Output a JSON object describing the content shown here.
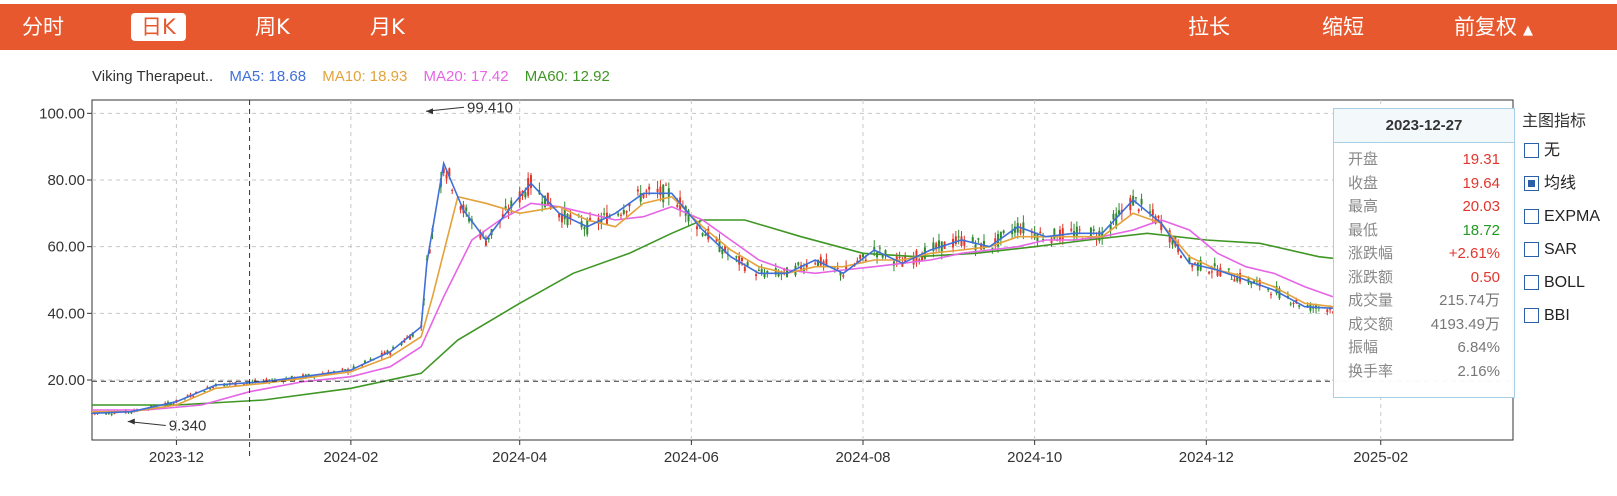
{
  "toolbar": {
    "tabs": [
      {
        "label": "分时",
        "active": false
      },
      {
        "label": "日K",
        "active": true
      },
      {
        "label": "周K",
        "active": false
      },
      {
        "label": "月K",
        "active": false
      }
    ],
    "right": [
      "拉长",
      "缩短",
      "前复权"
    ],
    "adjust_icon": "triangle-up-icon",
    "accent": "#e8582e"
  },
  "legend": {
    "name": "Viking Therapeut..",
    "ma5": "MA5: 18.68",
    "ma10": "MA10: 18.93",
    "ma20": "MA20: 17.42",
    "ma60": "MA60: 12.92"
  },
  "tooltip": {
    "date": "2023-12-27",
    "rows": [
      {
        "k": "开盘",
        "v": "19.31",
        "tone": "red"
      },
      {
        "k": "收盘",
        "v": "19.64",
        "tone": "red"
      },
      {
        "k": "最高",
        "v": "20.03",
        "tone": "red"
      },
      {
        "k": "最低",
        "v": "18.72",
        "tone": "green"
      },
      {
        "k": "涨跌幅",
        "v": "+2.61%",
        "tone": "red"
      },
      {
        "k": "涨跌额",
        "v": "0.50",
        "tone": "red"
      },
      {
        "k": "成交量",
        "v": "215.74万",
        "tone": "gray"
      },
      {
        "k": "成交额",
        "v": "4193.49万",
        "tone": "gray"
      },
      {
        "k": "振幅",
        "v": "6.84%",
        "tone": "gray"
      },
      {
        "k": "换手率",
        "v": "2.16%",
        "tone": "gray"
      }
    ]
  },
  "indicators": {
    "title": "主图指标",
    "items": [
      {
        "label": "无",
        "checked": false
      },
      {
        "label": "均线",
        "checked": true
      },
      {
        "label": "EXPMA",
        "checked": false
      },
      {
        "label": "SAR",
        "checked": false
      },
      {
        "label": "BOLL",
        "checked": false
      },
      {
        "label": "BBI",
        "checked": false
      }
    ]
  },
  "chart_data": {
    "type": "line",
    "title": "",
    "y_ticks": [
      "100.00",
      "80.00",
      "60.00",
      "40.00",
      "20.00"
    ],
    "ylim": [
      2,
      104
    ],
    "xlim": [
      "2023-11-01",
      "2025-03-20"
    ],
    "x_ticks": [
      "2023-12",
      "2024-02",
      "2024-04",
      "2024-06",
      "2024-08",
      "2024-10",
      "2024-12",
      "2025-02"
    ],
    "crosshair": {
      "date": "2023-12-27",
      "price": 19.64
    },
    "annotations": [
      {
        "label": "99.410",
        "date": "2024-02-27",
        "price": 99.41
      },
      {
        "label": "9.340",
        "date": "2023-11-13",
        "price": 9.34
      }
    ],
    "series": [
      {
        "name": "MA5",
        "color": "#3f6fd8",
        "x": [
          "2023-11-01",
          "2023-11-15",
          "2023-12-01",
          "2023-12-15",
          "2024-01-01",
          "2024-01-15",
          "2024-02-01",
          "2024-02-15",
          "2024-02-26",
          "2024-02-28",
          "2024-03-05",
          "2024-03-12",
          "2024-03-20",
          "2024-03-28",
          "2024-04-05",
          "2024-04-15",
          "2024-04-25",
          "2024-05-05",
          "2024-05-15",
          "2024-05-25",
          "2024-06-05",
          "2024-06-15",
          "2024-06-25",
          "2024-07-05",
          "2024-07-15",
          "2024-07-25",
          "2024-08-05",
          "2024-08-15",
          "2024-08-25",
          "2024-09-05",
          "2024-09-15",
          "2024-09-25",
          "2024-10-05",
          "2024-10-15",
          "2024-10-25",
          "2024-11-05",
          "2024-11-15",
          "2024-11-25",
          "2024-12-05",
          "2024-12-15",
          "2024-12-25",
          "2025-01-05",
          "2025-01-15"
        ],
        "values": [
          10.0,
          10.5,
          13.5,
          18.5,
          19.5,
          21.0,
          23.0,
          28.5,
          36.0,
          55.0,
          85.0,
          71.0,
          62.0,
          71.0,
          79.0,
          70.0,
          66.0,
          70.0,
          76.0,
          76.0,
          65.0,
          57.0,
          52.0,
          52.0,
          56.0,
          52.0,
          59.0,
          55.0,
          59.0,
          62.0,
          60.0,
          66.0,
          63.0,
          64.0,
          64.0,
          74.0,
          67.0,
          55.0,
          53.0,
          50.0,
          47.0,
          42.0,
          41.5
        ]
      },
      {
        "name": "MA10",
        "color": "#e3a23a",
        "x": [
          "2023-11-01",
          "2023-11-15",
          "2023-12-01",
          "2023-12-15",
          "2024-01-01",
          "2024-01-15",
          "2024-02-01",
          "2024-02-15",
          "2024-02-26",
          "2024-03-01",
          "2024-03-10",
          "2024-03-20",
          "2024-04-01",
          "2024-04-15",
          "2024-04-25",
          "2024-05-05",
          "2024-05-15",
          "2024-05-25",
          "2024-06-05",
          "2024-06-15",
          "2024-06-25",
          "2024-07-05",
          "2024-07-15",
          "2024-07-25",
          "2024-08-05",
          "2024-08-15",
          "2024-08-25",
          "2024-09-05",
          "2024-09-15",
          "2024-09-25",
          "2024-10-05",
          "2024-10-15",
          "2024-10-25",
          "2024-11-05",
          "2024-11-15",
          "2024-11-25",
          "2024-12-05",
          "2024-12-15",
          "2024-12-25",
          "2025-01-05",
          "2025-01-15"
        ],
        "values": [
          10.5,
          10.5,
          12.5,
          17.5,
          19.0,
          20.5,
          22.5,
          27.0,
          33.0,
          45.0,
          75.0,
          73.0,
          70.0,
          72.0,
          68.0,
          66.0,
          73.0,
          75.0,
          66.0,
          59.0,
          54.0,
          52.0,
          54.0,
          54.0,
          56.0,
          56.0,
          58.0,
          59.0,
          60.0,
          63.0,
          63.0,
          63.0,
          63.0,
          70.0,
          67.0,
          57.0,
          53.0,
          51.0,
          48.0,
          43.0,
          42.0
        ]
      },
      {
        "name": "MA20",
        "color": "#e664e6",
        "x": [
          "2023-11-01",
          "2023-11-20",
          "2023-12-10",
          "2023-12-27",
          "2024-01-15",
          "2024-02-01",
          "2024-02-15",
          "2024-02-26",
          "2024-03-05",
          "2024-03-15",
          "2024-03-25",
          "2024-04-05",
          "2024-04-15",
          "2024-04-25",
          "2024-05-05",
          "2024-05-15",
          "2024-05-25",
          "2024-06-05",
          "2024-06-15",
          "2024-06-25",
          "2024-07-05",
          "2024-07-15",
          "2024-07-25",
          "2024-08-05",
          "2024-08-15",
          "2024-08-25",
          "2024-09-05",
          "2024-09-15",
          "2024-09-25",
          "2024-10-05",
          "2024-10-15",
          "2024-10-25",
          "2024-11-05",
          "2024-11-15",
          "2024-11-25",
          "2024-12-05",
          "2024-12-15",
          "2024-12-25",
          "2025-01-05",
          "2025-01-15"
        ],
        "values": [
          11.0,
          11.0,
          12.5,
          16.5,
          19.5,
          21.0,
          24.0,
          30.0,
          45.0,
          62.0,
          68.0,
          73.0,
          72.0,
          70.0,
          68.0,
          69.0,
          72.0,
          68.0,
          62.0,
          56.0,
          53.0,
          52.0,
          53.0,
          54.0,
          55.0,
          56.0,
          58.0,
          59.0,
          60.0,
          62.0,
          62.0,
          63.0,
          65.0,
          68.0,
          65.0,
          58.0,
          54.0,
          52.0,
          48.0,
          45.0
        ]
      },
      {
        "name": "MA60",
        "color": "#3f9624",
        "x": [
          "2023-11-01",
          "2023-12-01",
          "2024-01-01",
          "2024-02-01",
          "2024-02-26",
          "2024-03-10",
          "2024-04-01",
          "2024-04-20",
          "2024-05-10",
          "2024-05-25",
          "2024-06-05",
          "2024-06-20",
          "2024-07-10",
          "2024-08-01",
          "2024-08-20",
          "2024-09-10",
          "2024-10-01",
          "2024-10-20",
          "2024-11-10",
          "2024-12-01",
          "2024-12-20",
          "2025-01-10",
          "2025-01-15"
        ],
        "values": [
          12.5,
          12.5,
          14.0,
          17.5,
          22.0,
          32.0,
          43.0,
          52.0,
          58.0,
          64.0,
          68.0,
          68.0,
          63.0,
          58.0,
          57.0,
          58.0,
          60.0,
          62.0,
          64.0,
          62.0,
          61.0,
          57.0,
          56.5
        ]
      }
    ]
  }
}
